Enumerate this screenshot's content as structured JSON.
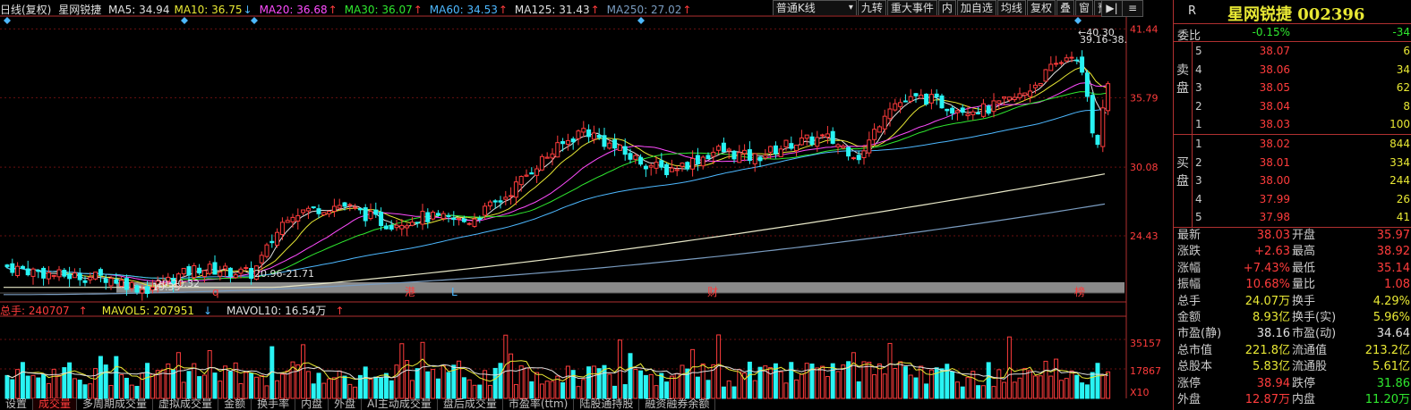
{
  "topbar": {
    "period": "日线(复权)",
    "stock": "星网锐捷",
    "ma": [
      {
        "label": "MA5: 34.94",
        "arrow": "",
        "color": "#e0e0e0"
      },
      {
        "label": "MA10: 36.75",
        "arrow": "↓",
        "color": "#e8e834"
      },
      {
        "label": "MA20: 36.68",
        "arrow": "↑",
        "color": "#ff4cff"
      },
      {
        "label": "MA30: 36.07",
        "arrow": "↑",
        "color": "#2fe82f"
      },
      {
        "label": "MA60: 34.53",
        "arrow": "↑",
        "color": "#4db8ff"
      },
      {
        "label": "MA125: 31.43",
        "arrow": "↑",
        "color": "#e0e0e0"
      },
      {
        "label": "MA250: 27.02",
        "arrow": "↑",
        "color": "#7a9cc0"
      }
    ],
    "buttons": [
      "普通K线",
      "九转",
      "重大事件",
      "内",
      "加自选",
      "均线",
      "复权",
      "叠",
      "窗",
      "预测"
    ],
    "arrow_icons": [
      "play-end-icon",
      "menu-down-icon"
    ]
  },
  "price_axis": [
    "41.44",
    "35.79",
    "30.08",
    "24.43"
  ],
  "annotations": {
    "high": "40.30",
    "range_right": "39.16-38.",
    "low1": "20.32",
    "low1_prefix": "20.",
    "low2": "19.35",
    "range_left": "20.96-21.71"
  },
  "event_markers": [
    "q",
    "港",
    "L",
    "财",
    "榜"
  ],
  "volume": {
    "legend": [
      {
        "label": "总手: 240707",
        "arrow": "↑",
        "color": "#ff3c3c"
      },
      {
        "label": "MAVOL5: 207951",
        "arrow": "↓",
        "color": "#e8e834"
      },
      {
        "label": "MAVOL10: 16.54万",
        "arrow": "↑",
        "color": "#e0e0e0"
      }
    ],
    "axis": [
      "35157",
      "17867"
    ],
    "x_label": "X10"
  },
  "bottom_tabs": [
    "设置",
    "成交量",
    "多周期成交量",
    "虚拟成交量",
    "金额",
    "换手率",
    "内盘",
    "外盘",
    "AI主动成交量",
    "盘后成交量",
    "市盈率(ttm)",
    "陆股通持股",
    "融资融券余额"
  ],
  "side": {
    "badge": "R",
    "title": "星网锐捷 002396",
    "weibi": {
      "label": "委比",
      "pct": "-0.15%",
      "diff": "-34"
    },
    "sell_label": "卖盘",
    "buy_label": "买盘",
    "sell": [
      {
        "lvl": "5",
        "price": "38.07",
        "vol": "6"
      },
      {
        "lvl": "4",
        "price": "38.06",
        "vol": "34"
      },
      {
        "lvl": "3",
        "price": "38.05",
        "vol": "62"
      },
      {
        "lvl": "2",
        "price": "38.04",
        "vol": "8"
      },
      {
        "lvl": "1",
        "price": "38.03",
        "vol": "100"
      }
    ],
    "buy": [
      {
        "lvl": "1",
        "price": "38.02",
        "vol": "844"
      },
      {
        "lvl": "2",
        "price": "38.01",
        "vol": "334"
      },
      {
        "lvl": "3",
        "price": "38.00",
        "vol": "244"
      },
      {
        "lvl": "4",
        "price": "37.99",
        "vol": "26"
      },
      {
        "lvl": "5",
        "price": "37.98",
        "vol": "41"
      }
    ],
    "stats": [
      {
        "l1": "最新",
        "v1": "38.03",
        "c1": "red",
        "l2": "开盘",
        "v2": "35.97",
        "c2": "red"
      },
      {
        "l1": "涨跌",
        "v1": "+2.63",
        "c1": "red",
        "l2": "最高",
        "v2": "38.92",
        "c2": "red"
      },
      {
        "l1": "涨幅",
        "v1": "+7.43%",
        "c1": "red",
        "l2": "最低",
        "v2": "35.14",
        "c2": "red"
      },
      {
        "l1": "振幅",
        "v1": "10.68%",
        "c1": "red",
        "l2": "量比",
        "v2": "1.08",
        "c2": "red"
      },
      {
        "l1": "总手",
        "v1": "24.07万",
        "c1": "yel",
        "l2": "换手",
        "v2": "4.29%",
        "c2": "yel"
      },
      {
        "l1": "金额",
        "v1": "8.93亿",
        "c1": "yel",
        "l2": "换手(实)",
        "v2": "5.96%",
        "c2": "yel"
      },
      {
        "l1": "市盈(静)",
        "v1": "38.16",
        "c1": "wht",
        "l2": "市盈(动)",
        "v2": "34.64",
        "c2": "wht"
      },
      {
        "l1": "总市值",
        "v1": "221.8亿",
        "c1": "yel",
        "l2": "流通值",
        "v2": "213.2亿",
        "c2": "yel"
      },
      {
        "l1": "总股本",
        "v1": "5.83亿",
        "c1": "yel",
        "l2": "流通股",
        "v2": "5.61亿",
        "c2": "yel"
      },
      {
        "l1": "涨停",
        "v1": "38.94",
        "c1": "red",
        "l2": "跌停",
        "v2": "31.86",
        "c2": "grn"
      },
      {
        "l1": "外盘",
        "v1": "12.87万",
        "c1": "red",
        "l2": "内盘",
        "v2": "11.20万",
        "c2": "grn"
      }
    ]
  }
}
